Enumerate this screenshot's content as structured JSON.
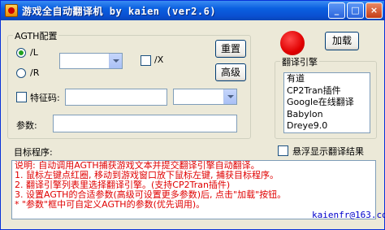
{
  "window": {
    "title": "游戏全自动翻译机   by kaien (ver2.6)",
    "buttons": {
      "minimize": "_",
      "maximize": "□",
      "close": "×"
    }
  },
  "agth_group": {
    "label": "AGTH配置",
    "radio_l": {
      "label": "/L",
      "checked": true
    },
    "radio_r": {
      "label": "/R",
      "checked": false
    },
    "checkbox_x": {
      "label": "/X",
      "checked": false
    },
    "checkbox_code": {
      "label": "特征码:",
      "checked": false
    },
    "params_label": "参数:",
    "params_value": "",
    "code_value": "",
    "combo_l_value": "",
    "combo_code_value": "",
    "reset_button": "重置",
    "advanced_button": "高级"
  },
  "load_button": "加载",
  "engine_group": {
    "label": "翻译引擎",
    "items": [
      {
        "label": "有道",
        "checked": false
      },
      {
        "label": "CP2Tran插件",
        "checked": false
      },
      {
        "label": "Google在线翻译",
        "checked": false
      },
      {
        "label": "Babylon",
        "checked": false
      },
      {
        "label": "Dreye9.0",
        "checked": false
      }
    ]
  },
  "target_label": "目标程序:",
  "float_checkbox": {
    "label": "悬浮显示翻译结果",
    "checked": false
  },
  "instructions": [
    "说明: 自动调用AGTH捕获游戏文本并提交翻译引擎自动翻译。",
    "  1. 鼠标左键点红圈, 移动到游戏窗口放下鼠标左键, 捕获目标程序。",
    "  2. 翻译引擎列表里选择翻译引擎。(支持CP2Tran插件)",
    "  3. 设置AGTH的合适参数(高级可设置更多参数)后, 点击\"加载\"按钮。",
    "  * \"参数\"框中可自定义AGTH的参数(优先调用)。"
  ],
  "credit": "kaienfr@163.com",
  "colors": {
    "title_bar": "#0a5fe0",
    "instruction_text": "#e00000",
    "credit_text": "#0000cc",
    "capture_target": "#e00000"
  }
}
